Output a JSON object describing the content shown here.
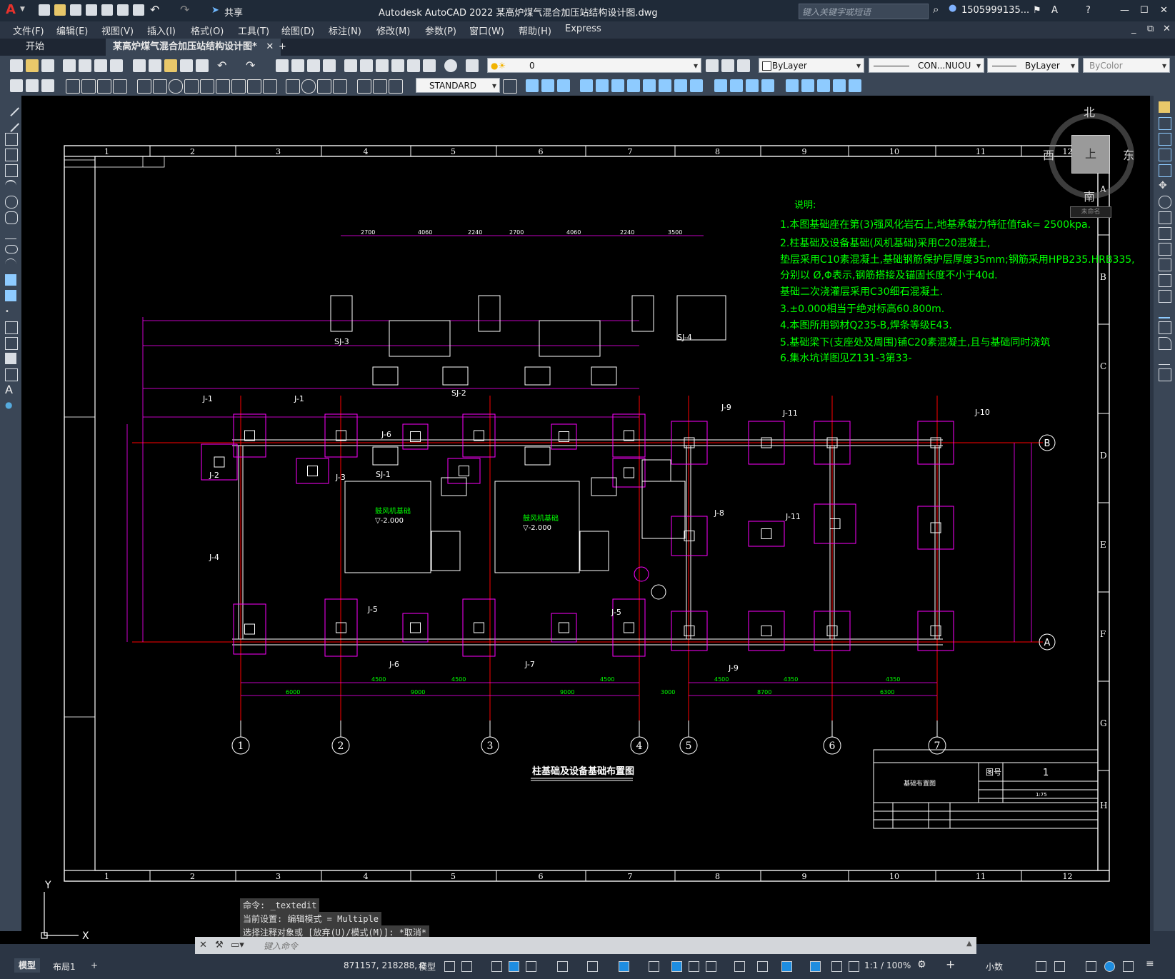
{
  "titlebar": {
    "app_logo": "A",
    "share": "共享",
    "title": "Autodesk AutoCAD 2022    某高炉煤气混合加压站结构设计图.dwg",
    "search_placeholder": "键入关键字或短语",
    "user": "1505999135...",
    "icons": [
      "new-icon",
      "open-icon",
      "save-icon",
      "saveas-icon",
      "plot-icon",
      "undo-icon",
      "redo-icon",
      "share-icon",
      "search-icon",
      "user-icon",
      "cart-icon",
      "help-icon",
      "minimize-icon",
      "maximize-icon",
      "close-icon"
    ]
  },
  "menubar": {
    "items": [
      "文件(F)",
      "编辑(E)",
      "视图(V)",
      "插入(I)",
      "格式(O)",
      "工具(T)",
      "绘图(D)",
      "标注(N)",
      "修改(M)",
      "参数(P)",
      "窗口(W)",
      "帮助(H)",
      "Express"
    ]
  },
  "tabs": {
    "items": [
      {
        "label": "开始",
        "active": false
      },
      {
        "label": "某高炉煤气混合加压站结构设计图*",
        "active": true
      }
    ],
    "add": "+"
  },
  "toolbar": {
    "layer_value": "0",
    "color_value": "ByLayer",
    "linetype_value": "CON...NUOU",
    "lineweight_value": "ByLayer",
    "plotstyle_value": "ByColor",
    "textstyle_value": "STANDARD"
  },
  "viewcube": {
    "north": "北",
    "south": "南",
    "east": "东",
    "west": "西",
    "top": "上",
    "wcs": "未命名"
  },
  "drawing": {
    "grid_cols": [
      "1",
      "2",
      "3",
      "4",
      "5",
      "6",
      "7",
      "8",
      "9",
      "10",
      "11",
      "12"
    ],
    "grid_rows": [
      "A",
      "B",
      "C",
      "D",
      "E",
      "F",
      "G",
      "H"
    ],
    "title": "柱基础及设备基础布置图",
    "axis_numbers": [
      "1",
      "2",
      "3",
      "4",
      "5",
      "6",
      "7"
    ],
    "axis_letters": [
      "B",
      "A"
    ],
    "notes": {
      "heading": "说明:",
      "lines": [
        "1.本图基础座在第(3)强风化岩石上,地基承载力特征值fak= 2500kpa.",
        "2.柱基础及设备基础(风机基础)采用C20混凝土,",
        "  垫层采用C10素混凝土,基础钢筋保护层厚度35mm;钢筋采用HPB235.HRB335,",
        "  分别以 Ø,Φ表示,钢筋搭接及锚固长度不小于40d.",
        "  基础二次浇灌层采用C30细石混凝土.",
        "3.±0.000相当于绝对标高60.800m.",
        "4.本图所用钢材Q235-B,焊条等级E43.",
        "5.基础梁下(支座处及周围)铺C20素混凝土,且与基础同时浇筑",
        "6.集水坑详图见Z131-3第33-"
      ]
    },
    "foundation_labels": [
      "J-1",
      "J-1",
      "J-2",
      "J-3",
      "J-4",
      "J-5",
      "J-5",
      "J-6",
      "J-6",
      "J-7",
      "J-8",
      "J-9",
      "J-9",
      "J-10",
      "J-11",
      "J-11",
      "SJ-1",
      "SJ-2",
      "SJ-3",
      "SJ-4"
    ],
    "bottom_dims": [
      "4500",
      "4500",
      "4500",
      "4500",
      "4350",
      "4350"
    ],
    "bottom_dims2": [
      "6000",
      "9000",
      "9000",
      "3000",
      "8700",
      "6300"
    ],
    "top_dims": [
      "2700",
      "4060",
      "2240",
      "2700",
      "4060",
      "2240",
      "3500"
    ],
    "fan_labels": [
      "鼓风机基础",
      "鼓风机基础"
    ],
    "fan_elev": "▽-2.000",
    "titleblock": {
      "name": "基础布置图",
      "drawing_no_label": "图号",
      "drawing_no": "1",
      "scale": "1:75"
    },
    "ucs_x": "X",
    "ucs_y": "Y"
  },
  "command": {
    "history": [
      "命令: _textedit",
      "当前设置: 编辑模式 = Multiple",
      "选择注释对象或 [放弃(U)/模式(M)]: *取消*"
    ],
    "placeholder": "键入命令"
  },
  "statusbar": {
    "layout_tabs": [
      "模型",
      "布局1"
    ],
    "add": "+",
    "coords": "871157, 218288, 0",
    "model": "模型",
    "scale": "1:1 / 100%",
    "units": "小数"
  },
  "colors": {
    "green": "#00ff00",
    "magenta": "#ff00ff",
    "red": "#ff0000",
    "white": "#ffffff",
    "yellow": "#ffff00"
  }
}
